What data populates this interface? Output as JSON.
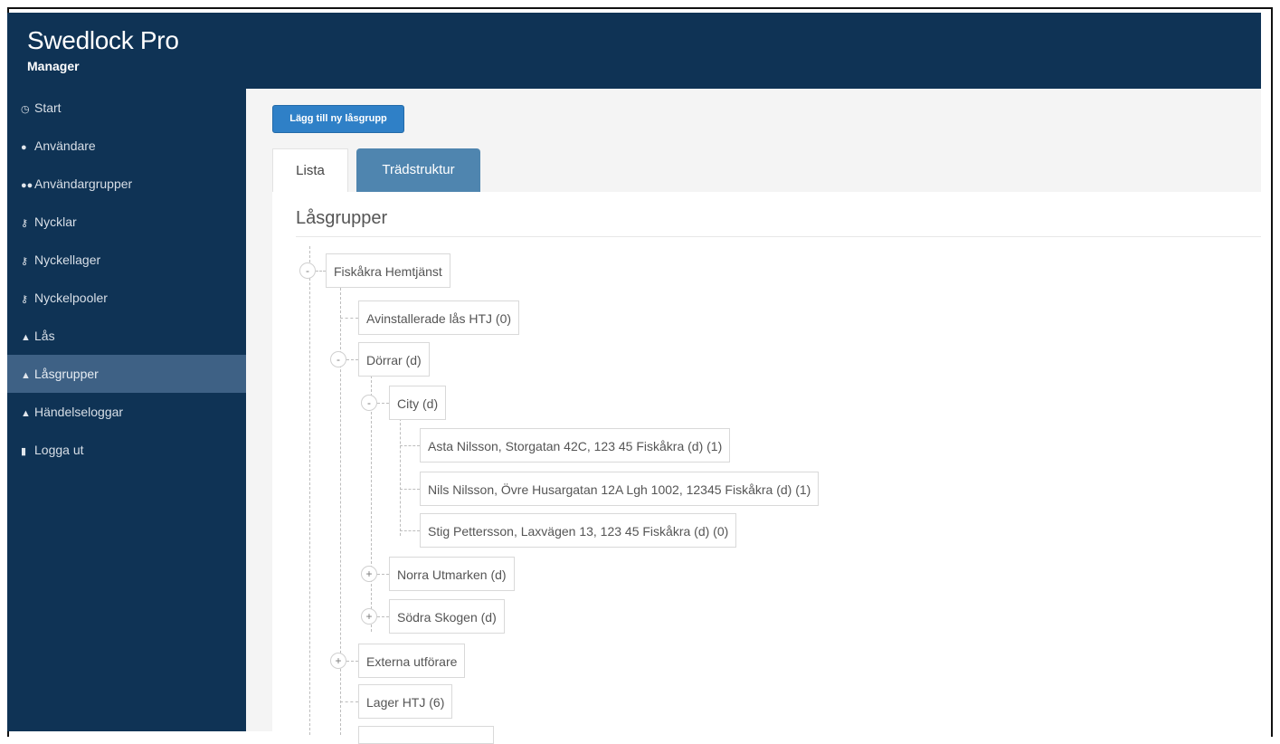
{
  "app": {
    "title": "Swedlock Pro",
    "subtitle": "Manager"
  },
  "sidebar": {
    "items": [
      {
        "label": "Start",
        "icon": "dashboard-icon",
        "glyph": "◷"
      },
      {
        "label": "Användare",
        "icon": "user-icon",
        "glyph": "●"
      },
      {
        "label": "Användargrupper",
        "icon": "users-icon",
        "glyph": "●●"
      },
      {
        "label": "Nycklar",
        "icon": "key-icon",
        "glyph": "⚷"
      },
      {
        "label": "Nyckellager",
        "icon": "key-icon",
        "glyph": "⚷"
      },
      {
        "label": "Nyckelpooler",
        "icon": "key-icon",
        "glyph": "⚷"
      },
      {
        "label": "Lås",
        "icon": "lock-icon",
        "glyph": "▲"
      },
      {
        "label": "Låsgrupper",
        "icon": "lock-icon",
        "glyph": "▲",
        "active": true
      },
      {
        "label": "Händelseloggar",
        "icon": "lock-icon",
        "glyph": "▲"
      },
      {
        "label": "Logga ut",
        "icon": "logout-icon",
        "glyph": "▮"
      }
    ]
  },
  "toolbar": {
    "add_label": "Lägg till ny låsgrupp"
  },
  "tabs": [
    {
      "label": "Lista"
    },
    {
      "label": "Trädstruktur",
      "active": true
    }
  ],
  "panel": {
    "title": "Låsgrupper"
  },
  "tree": {
    "nodes": [
      {
        "label": "Fiskåkra Hemtjänst",
        "toggle": "-"
      },
      {
        "label": "Avinstallerade lås HTJ (0)",
        "toggle": ""
      },
      {
        "label": "Dörrar (d)",
        "toggle": "-"
      },
      {
        "label": "City (d)",
        "toggle": "-"
      },
      {
        "label": "Asta Nilsson, Storgatan 42C, 123 45 Fiskåkra (d) (1)",
        "toggle": ""
      },
      {
        "label": "Nils Nilsson, Övre Husargatan 12A Lgh 1002, 12345 Fiskåkra (d) (1)",
        "toggle": ""
      },
      {
        "label": "Stig Pettersson, Laxvägen 13, 123 45 Fiskåkra (d) (0)",
        "toggle": ""
      },
      {
        "label": "Norra Utmarken (d)",
        "toggle": "+"
      },
      {
        "label": "Södra Skogen (d)",
        "toggle": "+"
      },
      {
        "label": "Externa utförare",
        "toggle": "+"
      },
      {
        "label": "Lager HTJ (6)",
        "toggle": ""
      }
    ]
  }
}
